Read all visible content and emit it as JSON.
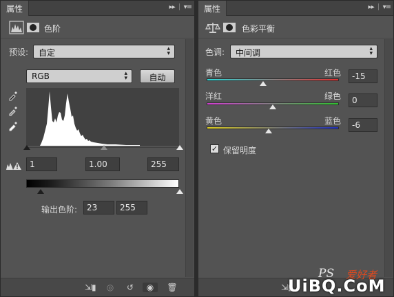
{
  "levels_panel": {
    "tab_label": "属性",
    "header_title": "色阶",
    "preset_label": "预设:",
    "preset_value": "自定",
    "channel_value": "RGB",
    "auto_button": "自动",
    "input_levels": {
      "black": "1",
      "gamma": "1.00",
      "white": "255"
    },
    "output_label": "输出色阶:",
    "output_levels": {
      "black": "23",
      "white": "255"
    }
  },
  "color_balance_panel": {
    "tab_label": "属性",
    "header_title": "色彩平衡",
    "tone_label": "色调:",
    "tone_value": "中间调",
    "sliders": [
      {
        "left_label": "青色",
        "right_label": "红色",
        "value": "-15",
        "gradient_left": "#2fd6d6",
        "gradient_right": "#e03030",
        "position": -15
      },
      {
        "left_label": "洋红",
        "right_label": "绿色",
        "value": "0",
        "gradient_left": "#d040d0",
        "gradient_right": "#30c030",
        "position": 0
      },
      {
        "left_label": "黄色",
        "right_label": "蓝色",
        "value": "-6",
        "gradient_left": "#e0d020",
        "gradient_right": "#2030c0",
        "position": -6
      }
    ],
    "preserve_luminosity_label": "保留明度",
    "preserve_luminosity_checked": true
  },
  "watermark": {
    "ps": "PS",
    "cn": "爱好者",
    "site": "UiBQ.CoM"
  },
  "colors": {
    "panel_bg": "#535353",
    "tabbar_bg": "#424242",
    "dropdown_bg": "#cfcfcf"
  }
}
